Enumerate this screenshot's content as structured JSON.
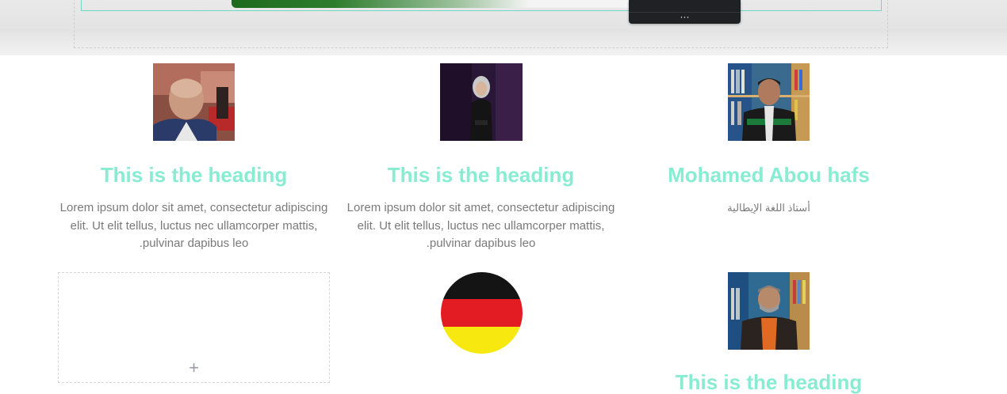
{
  "editor": {
    "toolbar_more": "···"
  },
  "team": [
    {
      "photo": "man-bald-portrait",
      "heading": "This is the heading",
      "text": "Lorem ipsum dolor sit amet, consectetur adipiscing elit. Ut elit tellus, luctus nec ullamcorper mattis, .pulvinar dapibus leo"
    },
    {
      "photo": "woman-hijab-portrait",
      "heading": "This is the heading",
      "text": "Lorem ipsum dolor sit amet, consectetur adipiscing elit. Ut elit tellus, luctus nec ullamcorper mattis, .pulvinar dapibus leo"
    },
    {
      "photo": "man-bookshelf-portrait",
      "heading": "Mohamed Abou hafs",
      "text": "أستاذ اللغة الإيطالية"
    }
  ],
  "second_row": {
    "add_icon": "+",
    "flag": {
      "name": "germany-flag",
      "colors": [
        "#141414",
        "#e31c24",
        "#f7e90f"
      ]
    },
    "photo": "man-bookshelf-portrait-2",
    "heading_partial": "This is the heading"
  },
  "colors": {
    "heading": "#88ecd3",
    "text": "#7a7a7a",
    "frame": "#71d7c7"
  }
}
